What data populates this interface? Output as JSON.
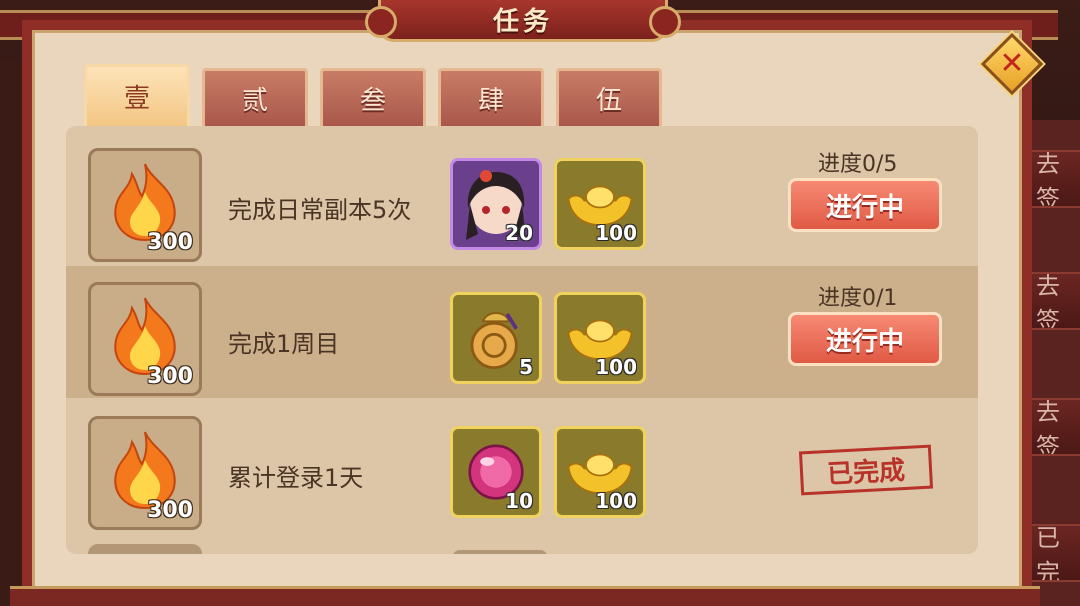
{
  "title": "任务",
  "tabs": [
    {
      "label": "壹",
      "active": true
    },
    {
      "label": "贰",
      "active": false
    },
    {
      "label": "叁",
      "active": false
    },
    {
      "label": "肆",
      "active": false
    },
    {
      "label": "伍",
      "active": false
    }
  ],
  "tasks": [
    {
      "icon": "flame-icon",
      "points": "300",
      "description": "完成日常副本5次",
      "rewards": [
        {
          "icon": "character-portrait-icon",
          "count": "20",
          "frame": "purple"
        },
        {
          "icon": "gold-ingot-icon",
          "count": "100",
          "frame": "gold"
        }
      ],
      "progress": "进度0/5",
      "status": "进行中"
    },
    {
      "icon": "flame-icon",
      "points": "300",
      "description": "完成1周目",
      "rewards": [
        {
          "icon": "coin-pouch-icon",
          "count": "5",
          "frame": "gold"
        },
        {
          "icon": "gold-ingot-icon",
          "count": "100",
          "frame": "gold"
        }
      ],
      "progress": "进度0/1",
      "status": "进行中"
    },
    {
      "icon": "flame-icon",
      "points": "300",
      "description": "累计登录1天",
      "rewards": [
        {
          "icon": "pink-orb-icon",
          "count": "10",
          "frame": "gold"
        },
        {
          "icon": "gold-ingot-icon",
          "count": "100",
          "frame": "gold"
        }
      ],
      "progress": "",
      "status": "已完成"
    }
  ],
  "background": {
    "side_buttons": [
      "去签",
      "去签",
      "去签",
      "已完"
    ]
  },
  "colors": {
    "frame_red": "#8e2e27",
    "parchment": "#e9d6bd",
    "button_red": "#e05a45",
    "stamp_red": "#b8322a"
  }
}
